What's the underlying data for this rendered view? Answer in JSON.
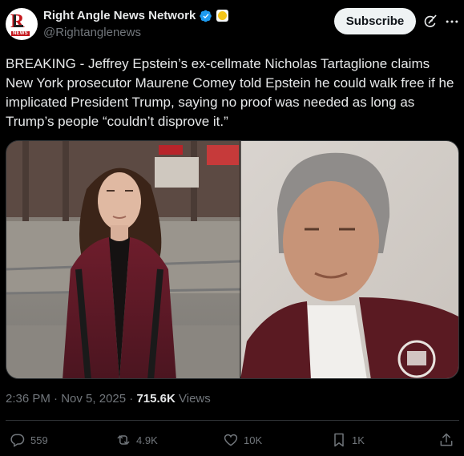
{
  "account": {
    "display_name": "Right Angle News Network",
    "handle": "@Rightanglenews",
    "avatar_logo_text": "NEWS"
  },
  "header": {
    "subscribe_label": "Subscribe"
  },
  "tweet": {
    "text": "BREAKING - Jeffrey Epstein’s ex-cellmate Nicholas Tartaglione claims New York prosecutor Maurene Comey told Epstein he could walk free if he implicated President Trump, saying no proof was needed as long as Trump’s people “couldn’t disprove it.”"
  },
  "meta": {
    "time": "2:36 PM",
    "date": "Nov 5, 2025",
    "views_count": "715.6K",
    "views_label": "Views"
  },
  "actions": {
    "replies": "559",
    "reposts": "4.9K",
    "likes": "10K",
    "bookmarks": "1K"
  },
  "colors": {
    "background": "#000000",
    "text_primary": "#e7e9ea",
    "text_secondary": "#71767b",
    "verified_blue": "#1d9bf0",
    "divider": "#2f3336"
  },
  "icons": {
    "verified": "verified-badge-icon",
    "affiliate": "affiliate-badge-icon",
    "grok": "grok-icon",
    "more": "more-options-icon",
    "reply": "reply-icon",
    "repost": "repost-icon",
    "like": "like-icon",
    "bookmark": "bookmark-icon",
    "share": "share-icon"
  }
}
